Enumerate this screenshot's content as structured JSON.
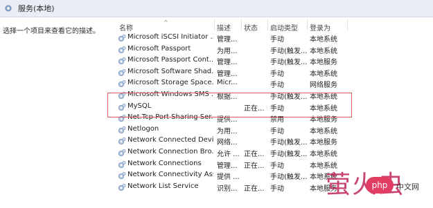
{
  "header": {
    "title": "服务(本地)"
  },
  "left": {
    "description": "选择一个项目来查看它的描述。"
  },
  "table": {
    "columns": {
      "name": "名称",
      "desc": "描述",
      "status": "状态",
      "startup": "启动类型",
      "logon": "登录为"
    },
    "rows": [
      {
        "name": "Microsoft iSCSI Initiator ...",
        "desc": "管理...",
        "status": "",
        "startup": "手动",
        "logon": "本地系统"
      },
      {
        "name": "Microsoft Passport",
        "desc": "为用...",
        "status": "",
        "startup": "手动(触发...",
        "logon": "本地系统"
      },
      {
        "name": "Microsoft Passport Cont...",
        "desc": "管理...",
        "status": "",
        "startup": "手动(触发...",
        "logon": "本地服务"
      },
      {
        "name": "Microsoft Software Shad...",
        "desc": "管理...",
        "status": "",
        "startup": "手动",
        "logon": "本地系统"
      },
      {
        "name": "Microsoft Storage Space...",
        "desc": "Micr...",
        "status": "",
        "startup": "手动",
        "logon": "网络服务"
      },
      {
        "name": "Microsoft Windows SMS ...",
        "desc": "根据...",
        "status": "",
        "startup": "手动(触发...",
        "logon": "本地系统"
      },
      {
        "name": "MySQL",
        "desc": "",
        "status": "正在...",
        "startup": "手动",
        "logon": "本地系统"
      },
      {
        "name": "Net.Tcp Port Sharing Ser...",
        "desc": "提供...",
        "status": "",
        "startup": "禁用",
        "logon": "本地服务"
      },
      {
        "name": "Netlogon",
        "desc": "为用...",
        "status": "",
        "startup": "手动",
        "logon": "本地系统"
      },
      {
        "name": "Network Connected Devi...",
        "desc": "网络...",
        "status": "",
        "startup": "手动(触发...",
        "logon": "本地服务"
      },
      {
        "name": "Network Connection Bro...",
        "desc": "允许 ...",
        "status": "正在...",
        "startup": "手动(触发...",
        "logon": "本地系统"
      },
      {
        "name": "Network Connections",
        "desc": "管理...",
        "status": "正在...",
        "startup": "手动",
        "logon": "本地系统"
      },
      {
        "name": "Network Connectivity Ass...",
        "desc": "提供 ...",
        "status": "",
        "startup": "手动(触发...",
        "logon": "本地系统"
      },
      {
        "name": "Network List Service",
        "desc": "识别...",
        "status": "正在...",
        "startup": "手动",
        "logon": "本地服务"
      }
    ]
  },
  "watermark": {
    "text": "萤火虫",
    "badge": "php",
    "cn": "中文网"
  },
  "colors": {
    "highlight": "#e05a5a",
    "watermark": "#c0245a",
    "badge": "#e23d62",
    "header_bg": "#e9eef6"
  },
  "icons": {
    "header": "gear-services-icon",
    "row": "service-gear-icon"
  }
}
